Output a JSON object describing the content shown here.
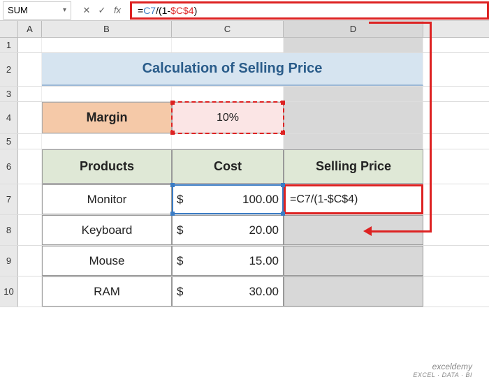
{
  "namebox": "SUM",
  "formula_bar": {
    "parts": {
      "eq": "=",
      "c7": "C7",
      "mid": "/(1-",
      "c4": "$C$4",
      "end": ")"
    }
  },
  "columns": [
    "A",
    "B",
    "C",
    "D"
  ],
  "rows": [
    "1",
    "2",
    "3",
    "4",
    "5",
    "6",
    "7",
    "8",
    "9",
    "10"
  ],
  "title": "Calculation of Selling Price",
  "margin": {
    "label": "Margin",
    "value": "10%"
  },
  "table": {
    "headers": {
      "products": "Products",
      "cost": "Cost",
      "price": "Selling Price"
    },
    "rows": [
      {
        "product": "Monitor",
        "currency": "$",
        "cost": "100.00"
      },
      {
        "product": "Keyboard",
        "currency": "$",
        "cost": "20.00"
      },
      {
        "product": "Mouse",
        "currency": "$",
        "cost": "15.00"
      },
      {
        "product": "RAM",
        "currency": "$",
        "cost": "30.00"
      }
    ]
  },
  "cell_formula": "=C7/(1-$C$4)",
  "fx_label": "fx",
  "watermark": {
    "main": "exceldemy",
    "sub": "EXCEL · DATA · BI"
  },
  "chart_data": {
    "type": "table",
    "title": "Calculation of Selling Price",
    "margin_percent": 10,
    "columns": [
      "Products",
      "Cost",
      "Selling Price"
    ],
    "rows": [
      [
        "Monitor",
        100.0,
        null
      ],
      [
        "Keyboard",
        20.0,
        null
      ],
      [
        "Mouse",
        15.0,
        null
      ],
      [
        "RAM",
        30.0,
        null
      ]
    ],
    "selling_price_formula": "=C7/(1-$C$4)"
  }
}
